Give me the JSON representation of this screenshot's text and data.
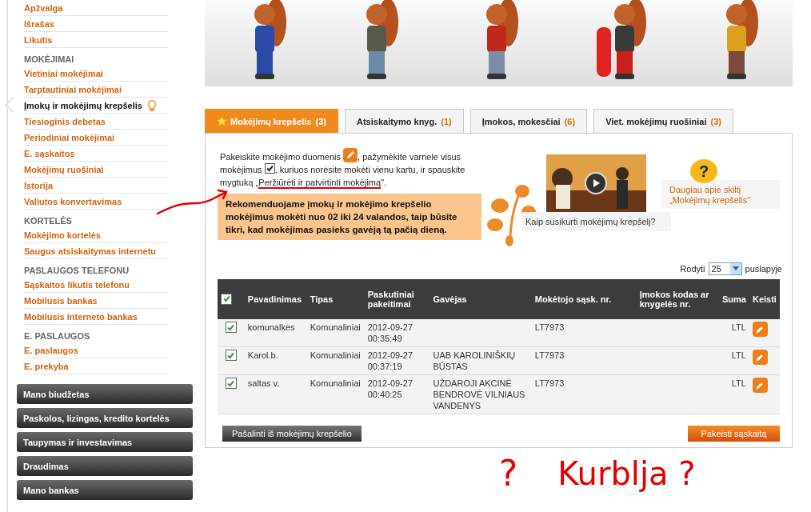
{
  "sidebar": {
    "sections": [
      {
        "items": [
          {
            "label": "Apžvalga",
            "selected": false
          },
          {
            "label": "Išrašas",
            "selected": false
          },
          {
            "label": "Likutis",
            "selected": false
          }
        ]
      },
      {
        "heading": "MOKĖJIMAI",
        "items": [
          {
            "label": "Vietiniai mokėjimai",
            "selected": false
          },
          {
            "label": "Tarptautiniai mokėjimai",
            "selected": false
          },
          {
            "label": "Įmokų ir mokėjimų krepšelis",
            "selected": true
          },
          {
            "label": "Tiesioginis debetas",
            "selected": false
          },
          {
            "label": "Periodiniai mokėjimai",
            "selected": false
          },
          {
            "label": "E. sąskaitos",
            "selected": false
          },
          {
            "label": "Mokėjimų ruošiniai",
            "selected": false
          },
          {
            "label": "Istorija",
            "selected": false
          },
          {
            "label": "Valiutos konvertavimas",
            "selected": false
          }
        ]
      },
      {
        "heading": "KORTELĖS",
        "items": [
          {
            "label": "Mokėjimo kortelės",
            "selected": false
          },
          {
            "label": "Saugus atsiskaitymas internetu",
            "selected": false
          }
        ]
      },
      {
        "heading": "PASLAUGOS TELEFONU",
        "items": [
          {
            "label": "Sąskaitos likutis telefonu",
            "selected": false
          },
          {
            "label": "Mobilusis bankas",
            "selected": false
          },
          {
            "label": "Mobilusis interneto bankas",
            "selected": false
          }
        ]
      },
      {
        "heading": "E. PASLAUGOS",
        "items": [
          {
            "label": "E. paslaugos",
            "selected": false
          },
          {
            "label": "E. prekyba",
            "selected": false
          }
        ]
      }
    ],
    "buttons": [
      "Mano biudžetas",
      "Paskolos, lizingas, kredito kortelės",
      "Taupymas ir investavimas",
      "Draudimas",
      "Mano bankas"
    ]
  },
  "tabs": [
    {
      "label": "Mokėjimų krepšelis",
      "count": "(3)",
      "selected": true
    },
    {
      "label": "Atsiskaitymo knyg.",
      "count": "(1)",
      "selected": false
    },
    {
      "label": "Įmokos, mokesčiai",
      "count": "(6)",
      "selected": false
    },
    {
      "label": "Viet. mokėjimų ruošiniai",
      "count": "(3)",
      "selected": false
    }
  ],
  "instructions": {
    "part_1": "Pakeiskite mokėjimo duomenis",
    "part_2": ", pažymėkite varnele visus mokėjimus",
    "part_3": ", kuriuos norėsite mokėti vienu kartu, ir spauskite mygtuką „",
    "link": "Peržiūrėti ir patvirtinti mokėjimą",
    "part_4": "\"."
  },
  "notice": "Rekomenduojame įmokų ir mokėjimo krepšelio mokėjimus mokėti nuo 02 iki 24 valandos, taip būsite tikri, kad mokėjimas pasieks gavėją tą pačią dieną.",
  "video": {
    "caption": "Kaip susikurti mokėjimų krepšelį?"
  },
  "help": {
    "icon": "?",
    "link": "Daugiau apie skiltį „Mokėjimų krepšelis\""
  },
  "paging": {
    "label_before": "Rodyti",
    "value": "25",
    "label_after": "puslapyje"
  },
  "table": {
    "all_checked": true,
    "columns": [
      "Pavadinimas",
      "Tipas",
      "Paskutiniai pakeitimai",
      "Gavėjas",
      "Mokėtojo sąsk. nr.",
      "Įmokos kodas ar knygelės nr.",
      "Suma",
      "Keisti"
    ],
    "rows": [
      {
        "checked": true,
        "name": "komunalkes",
        "type": "Komunaliniai",
        "date": "2012-09-27",
        "time": "00:35:49",
        "payee": "",
        "account": "LT7973",
        "currency": "LTL"
      },
      {
        "checked": true,
        "name": "Karol.b.",
        "type": "Komunaliniai",
        "date": "2012-09-27",
        "time": "00:37:19",
        "payee": "UAB KAROLINIŠKIŲ BŪSTAS",
        "account": "LT7973",
        "currency": "LTL"
      },
      {
        "checked": true,
        "name": "saltas v.",
        "type": "Komunaliniai",
        "date": "2012-09-27",
        "time": "00:40:25",
        "payee": "UŽDAROJI AKCINĖ BENDROVĖ VILNIAUS VANDENYS",
        "account": "LT7973",
        "currency": "LTL"
      }
    ]
  },
  "actions": {
    "remove": "Pašalinti iš mokėjimų krepšelio",
    "change": "Pakeisti sąskaitą"
  },
  "annotations": {
    "arrow": true,
    "underline": true,
    "question": "?",
    "text": "Kurblja ?"
  }
}
